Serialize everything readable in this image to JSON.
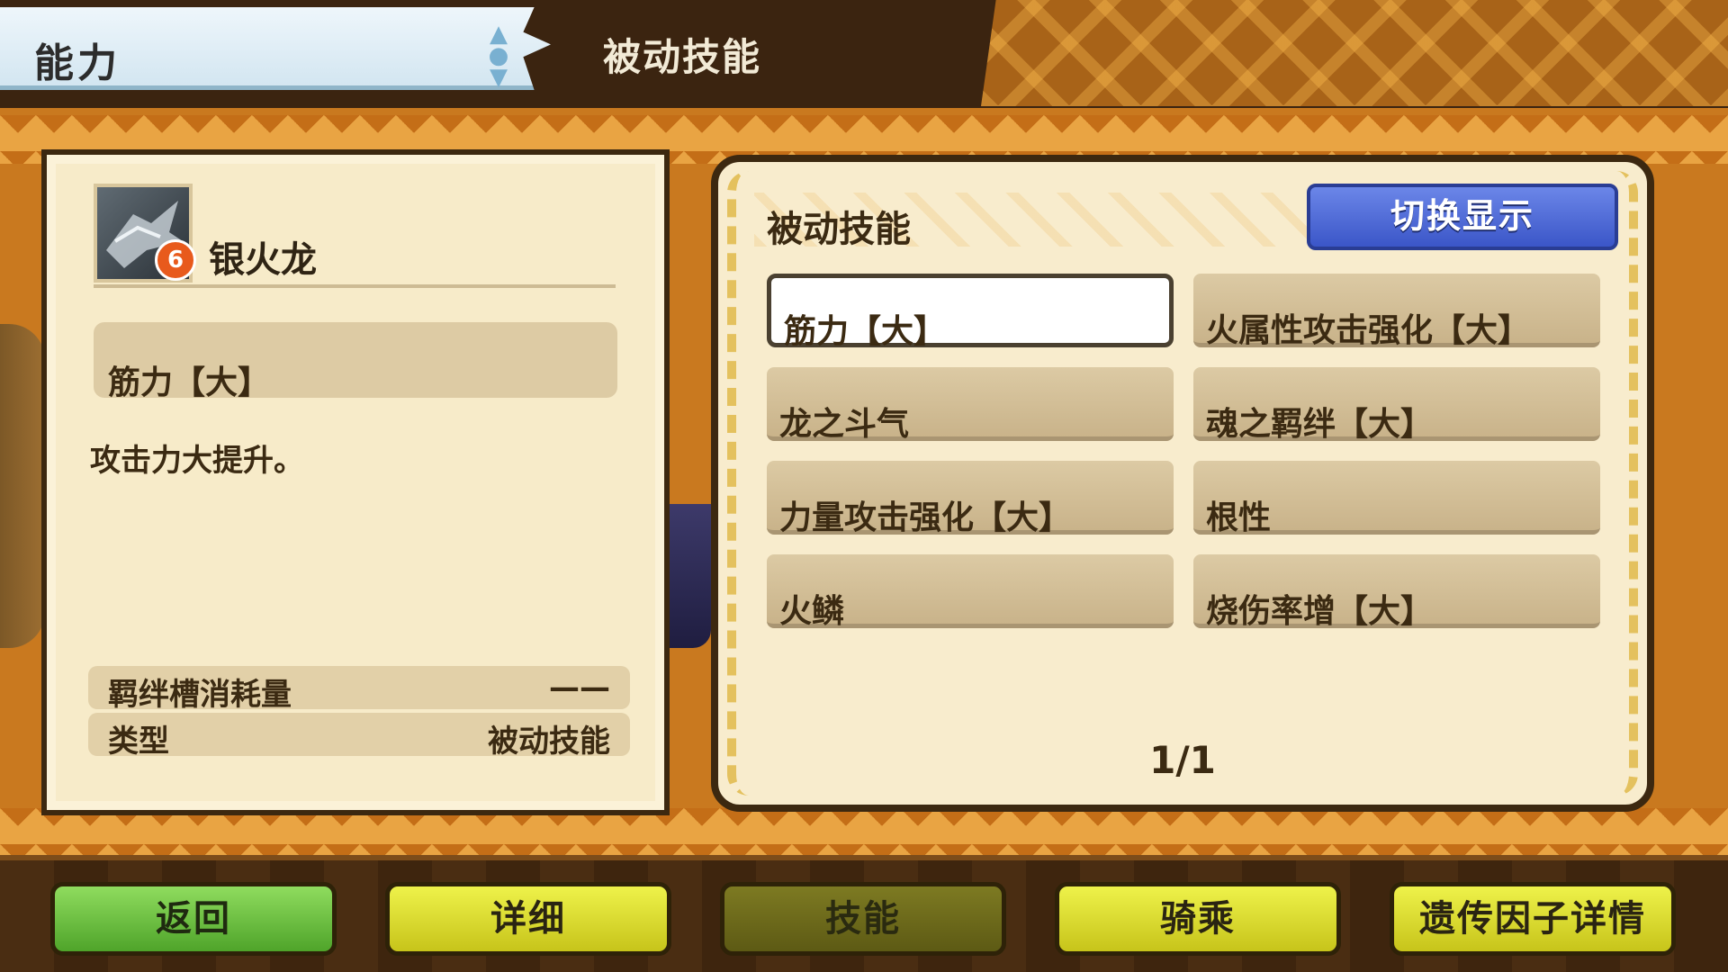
{
  "header": {
    "screen_title": "能力",
    "section_title": "被动技能"
  },
  "monster": {
    "name": "银火龙",
    "element_badge": "6"
  },
  "detail": {
    "skill_name": "筋力【大】",
    "description": "攻击力大提升。",
    "rows": [
      {
        "label": "羁绊槽消耗量",
        "value": "——"
      },
      {
        "label": "类型",
        "value": "被动技能"
      }
    ]
  },
  "skill_list": {
    "title": "被动技能",
    "switch_label": "切换显示",
    "selected_index": 0,
    "items": [
      "筋力【大】",
      "火属性攻击强化【大】",
      "龙之斗气",
      "魂之羁绊【大】",
      "力量攻击强化【大】",
      "根性",
      "火鳞",
      "烧伤率增【大】"
    ],
    "page": "1/1"
  },
  "nav": {
    "back": "返回",
    "detail": "详细",
    "skills": "技能",
    "ride": "骑乘",
    "gene": "遗传因子详情"
  },
  "colors": {
    "background": "#c9791f",
    "panel": "#f8eccd",
    "switch_button": "#3b56c8",
    "nav_green": "#4fa42a",
    "nav_yellow": "#c7c41a",
    "nav_active": "#5d5a14"
  },
  "icons": {
    "monster_portrait": "silver-rathalos-portrait",
    "element": "fire-element-icon",
    "scroll": "scroll-arrows-icon"
  }
}
